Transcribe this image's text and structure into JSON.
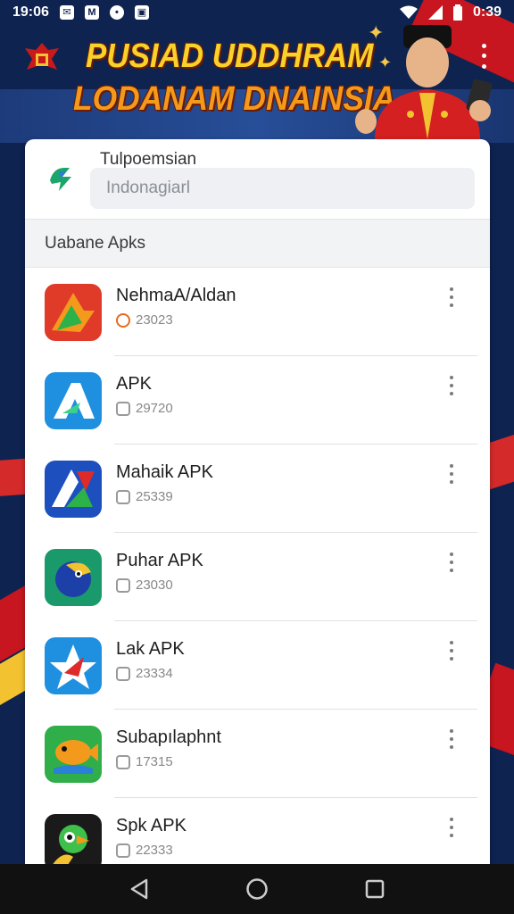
{
  "status_bar": {
    "time": "19:06",
    "right_text": "0:39",
    "icons": [
      "mail-icon",
      "m-app-icon",
      "chat-icon",
      "gallery-icon",
      "wifi-icon",
      "signal-icon",
      "battery-icon"
    ]
  },
  "header": {
    "title_line1": "PUSIAD UDDHRAM",
    "title_line2": "LODANAM DNAINSIA",
    "emblem": "garuda-emblem-icon",
    "menu_icon": "more-vertical-icon"
  },
  "search": {
    "label": "Tulpoemsian",
    "value": "Indonagiarl"
  },
  "section_title": "Uabane Apks",
  "apps": [
    {
      "name": "NehmaA/Aldan",
      "meta": "23023",
      "icon": "red-orange-arrow-icon"
    },
    {
      "name": "APK",
      "meta": "29720",
      "icon": "blue-arrow-icon"
    },
    {
      "name": "Mahaik APK",
      "meta": "25339",
      "icon": "blue-red-arrow-icon"
    },
    {
      "name": "Puhar APK",
      "meta": "23030",
      "icon": "bird-icon"
    },
    {
      "name": "Lak APK",
      "meta": "23334",
      "icon": "star-arrow-icon"
    },
    {
      "name": "Subapılaphnt",
      "meta": "17315",
      "icon": "fish-icon"
    },
    {
      "name": "Spk APK",
      "meta": "22333",
      "icon": "parrot-icon"
    }
  ],
  "colors": {
    "accent_yellow": "#f8d12a",
    "accent_orange": "#f39a1d",
    "background_navy": "#0e2350",
    "flag_red": "#c7161f"
  },
  "navigation": [
    "back-icon",
    "home-icon",
    "recents-icon"
  ]
}
